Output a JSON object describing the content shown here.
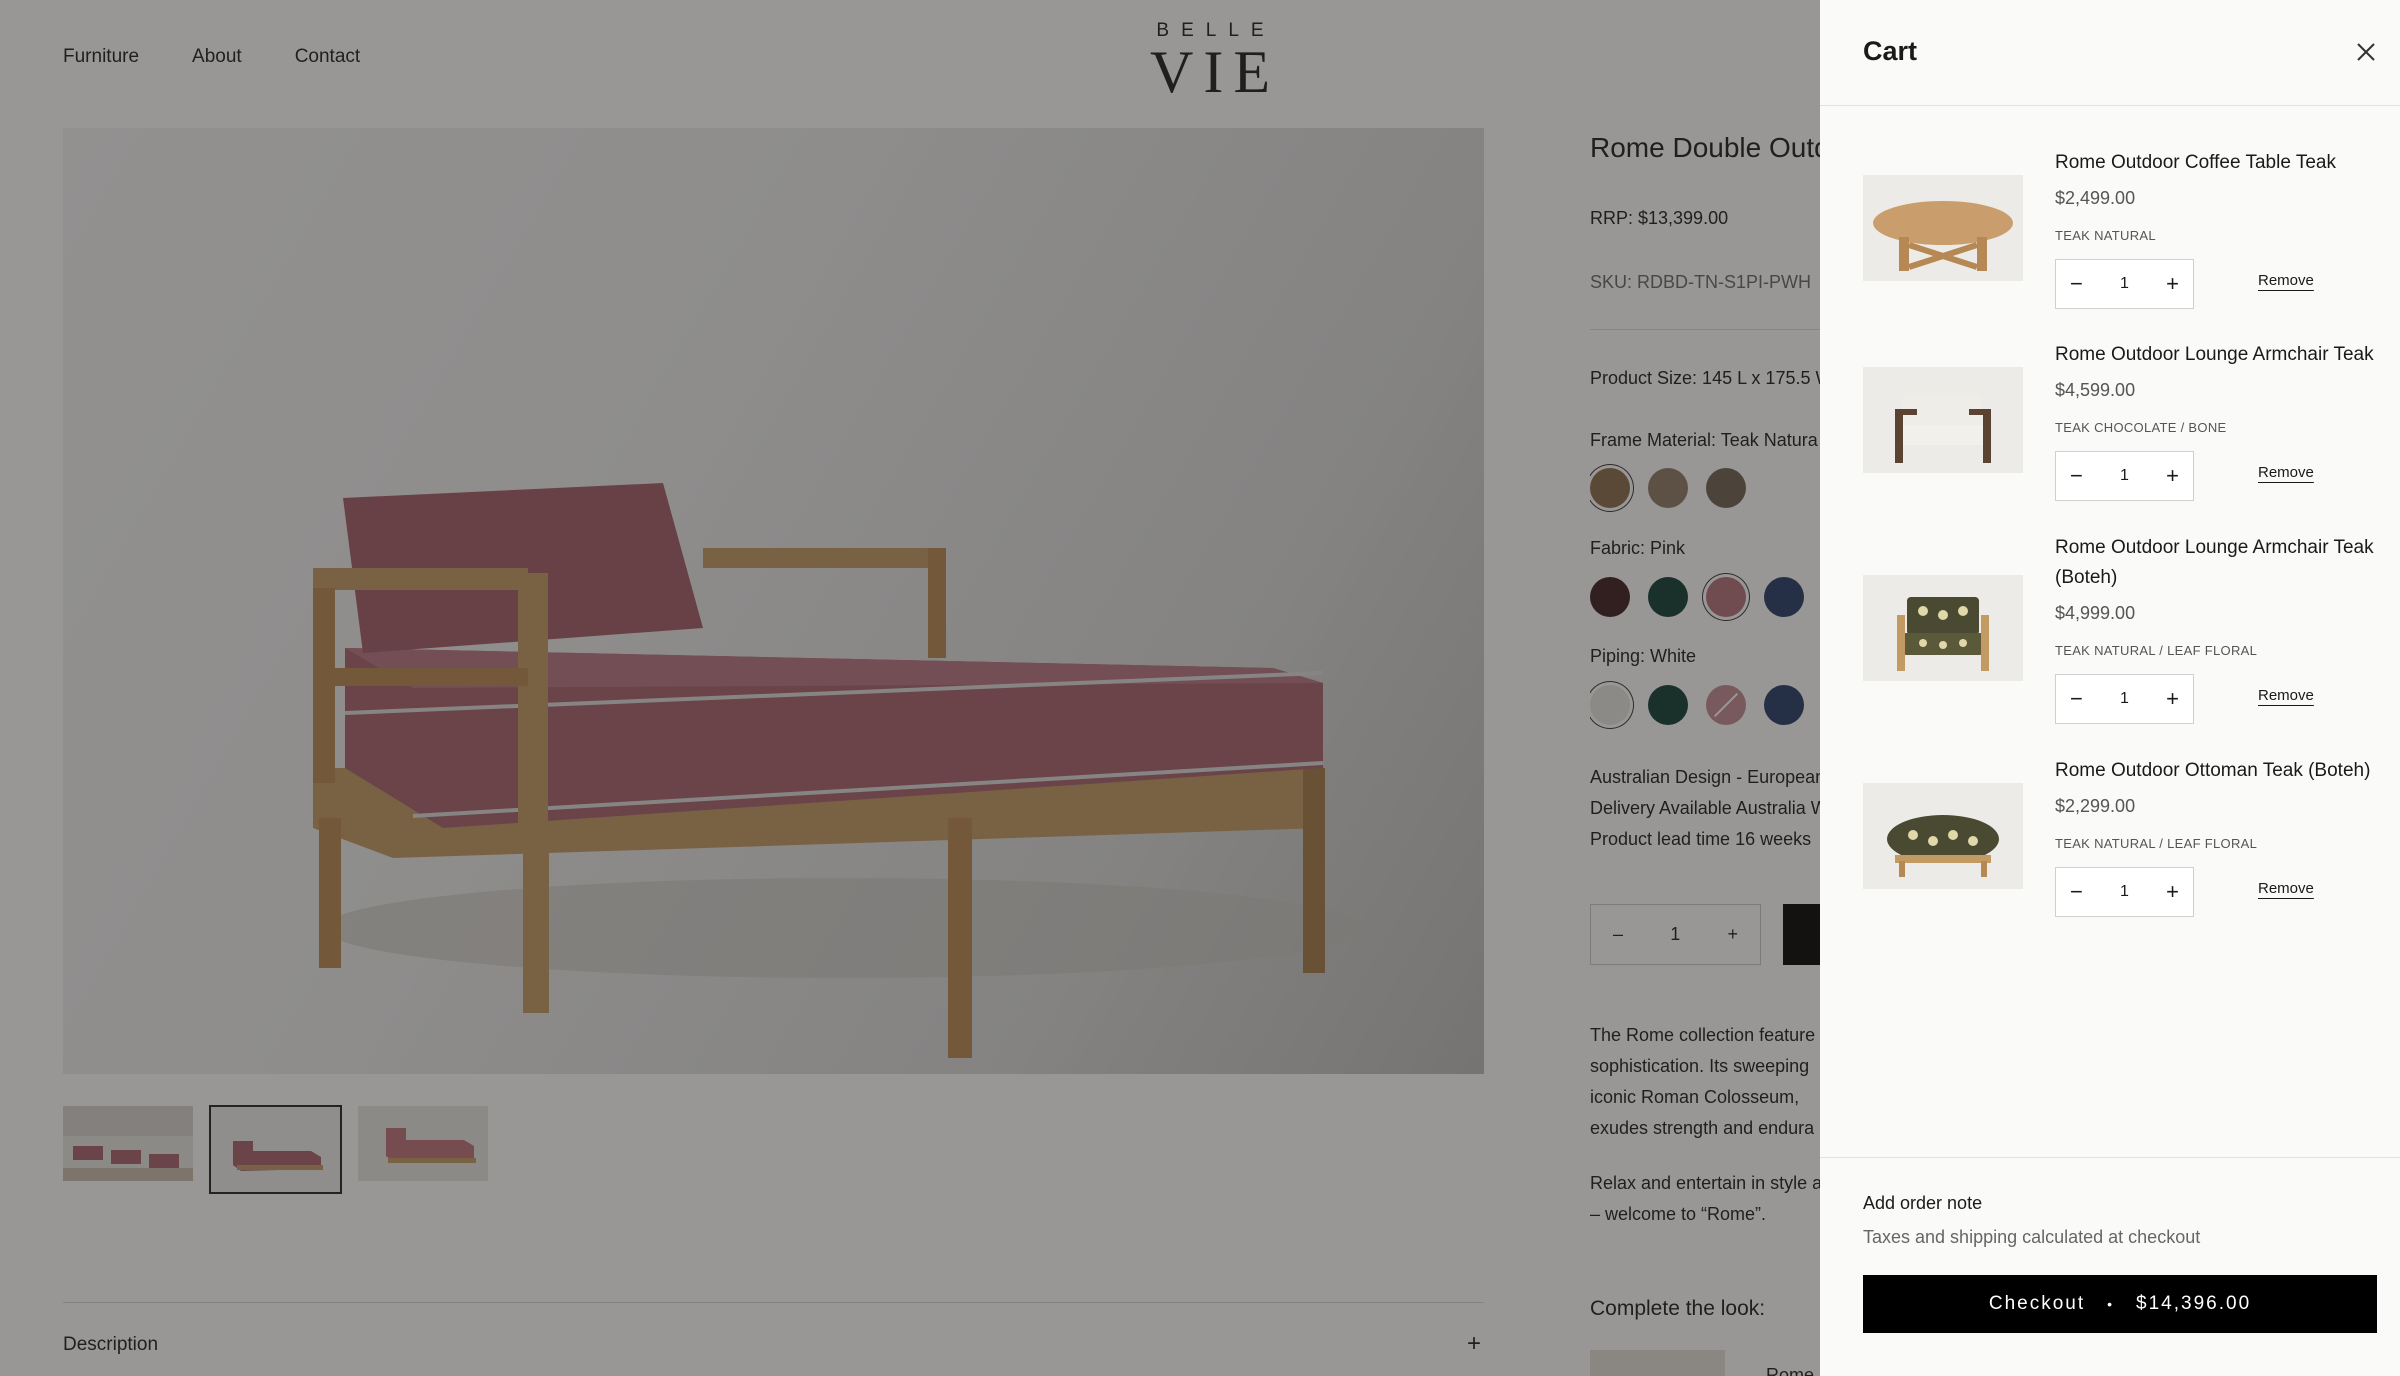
{
  "nav": {
    "items": [
      "Furniture",
      "About",
      "Contact"
    ],
    "logo_top": "BELLE",
    "logo_main": "VIE"
  },
  "product": {
    "title": "Rome Double Outdo",
    "rrp": "RRP: $13,399.00",
    "sku": "SKU: RDBD-TN-S1PI-PWH",
    "size": "Product Size: 145 L x 175.5 W",
    "frame_label": "Frame Material: Teak Natura",
    "fabric_label": "Fabric: Pink",
    "piping_label": "Piping: White",
    "notes": [
      "Australian Design - European",
      "Delivery Available Australia W",
      "Product lead time 16 weeks"
    ],
    "qty": "1",
    "qty_minus": "–",
    "qty_plus": "+",
    "description_lines": [
      "The Rome collection feature",
      "sophistication. Its sweeping",
      "iconic Roman Colosseum,",
      "exudes strength and endura"
    ],
    "description_lines_2": [
      "Relax and entertain in style a",
      "– welcome to “Rome”."
    ],
    "complete_look": "Complete the look:",
    "look_item": "Rome",
    "description_label": "Description",
    "description_plus": "+",
    "swatches": {
      "frame": [
        "#8a6a4b",
        "#8e7966",
        "#6e5e52"
      ],
      "fabric": [
        "#3c1a1e",
        "#0f3a33",
        "#b36f7a",
        "#233a66"
      ],
      "piping": [
        "#e7e7e1",
        "#0f3a33",
        "#c28a93",
        "#233a66"
      ]
    }
  },
  "cart": {
    "title": "Cart",
    "items": [
      {
        "name": "Rome Outdoor Coffee Table Teak",
        "price": "$2,499.00",
        "variant": "TEAK NATURAL",
        "qty": "1",
        "remove": "Remove"
      },
      {
        "name": "Rome Outdoor Lounge Armchair Teak",
        "price": "$4,599.00",
        "variant": "TEAK CHOCOLATE / BONE",
        "qty": "1",
        "remove": "Remove"
      },
      {
        "name": "Rome Outdoor Lounge Armchair Teak (Boteh)",
        "price": "$4,999.00",
        "variant": "TEAK NATURAL / LEAF FLORAL",
        "qty": "1",
        "remove": "Remove"
      },
      {
        "name": "Rome Outdoor Ottoman Teak (Boteh)",
        "price": "$2,299.00",
        "variant": "TEAK NATURAL / LEAF FLORAL",
        "qty": "1",
        "remove": "Remove"
      }
    ],
    "qty_minus": "−",
    "qty_plus": "+",
    "order_note": "Add order note",
    "tax_note": "Taxes and shipping calculated at checkout",
    "checkout_label": "Checkout",
    "checkout_sep": "•",
    "checkout_total": "$14,396.00"
  }
}
